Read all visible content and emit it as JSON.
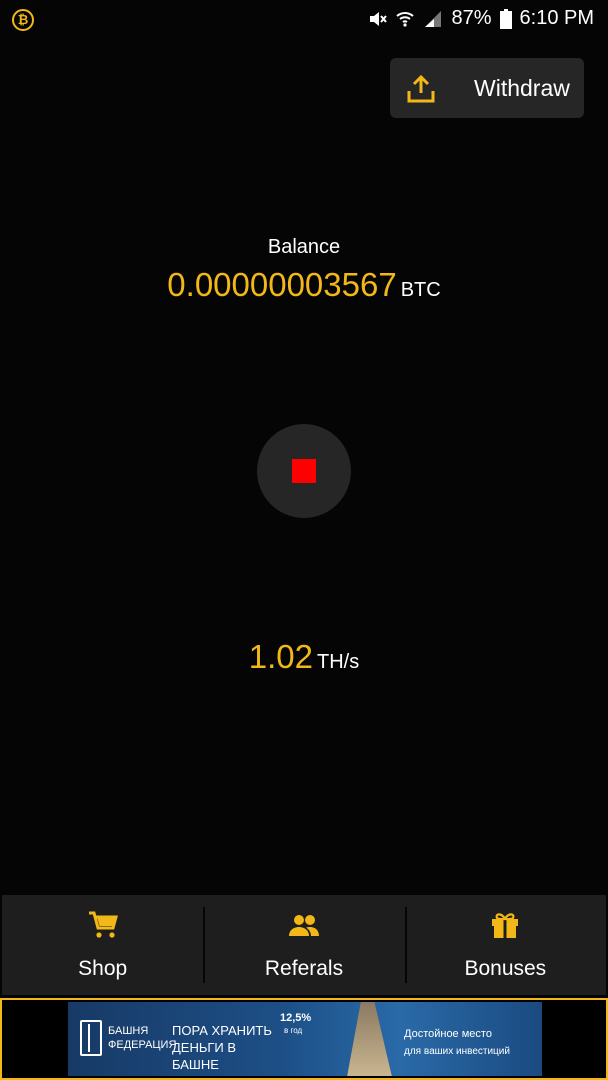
{
  "status_bar": {
    "app_icon": "bitcoin-icon",
    "battery": "87%",
    "time": "6:10 PM",
    "icons": [
      "mute-icon",
      "wifi-icon",
      "signal-icon",
      "battery-icon"
    ]
  },
  "withdraw": {
    "label": "Withdraw",
    "icon": "upload-icon"
  },
  "balance": {
    "label": "Balance",
    "value": "0.00000003567",
    "unit": "BTC"
  },
  "miner": {
    "control_icon": "stop-icon",
    "hashrate": "1.02",
    "hashrate_unit": "TH/s"
  },
  "nav": {
    "items": [
      {
        "label": "Shop",
        "icon": "cart-icon"
      },
      {
        "label": "Referals",
        "icon": "people-icon"
      },
      {
        "label": "Bonuses",
        "icon": "gift-icon"
      }
    ]
  },
  "ad": {
    "brand": "БАШНЯ ФЕДЕРАЦИЯ",
    "slogan": "ПОРА ХРАНИТЬ ДЕНЬГИ В БАШНЕ",
    "rate": "12,5%",
    "rate_period": "в год",
    "tagline_1": "Достойное место",
    "tagline_2": "для ваших инвестиций"
  },
  "colors": {
    "accent": "#f2b818",
    "background": "#050505",
    "surface": "#262626",
    "stop": "#ff0000"
  }
}
